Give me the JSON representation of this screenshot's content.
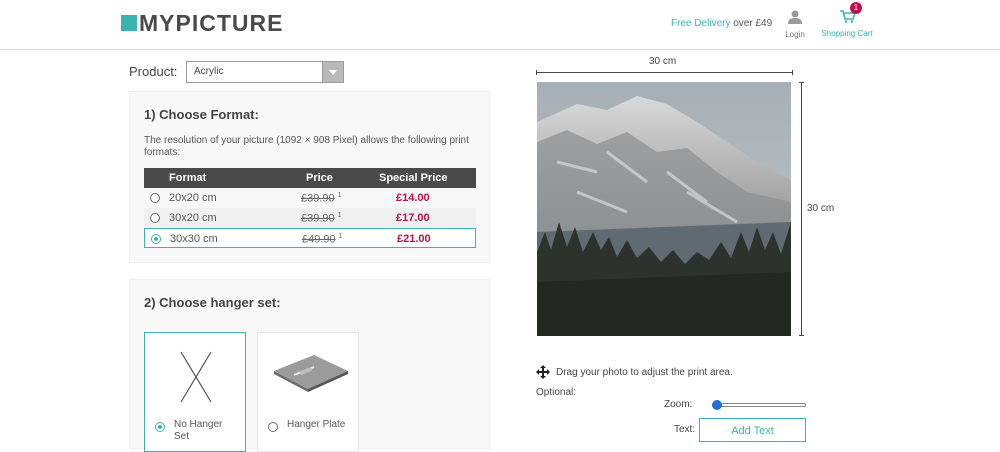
{
  "header": {
    "brand": "MYPICTURE",
    "delivery_accent": "Free Delivery",
    "delivery_rest": " over £49",
    "login_label": "Login",
    "cart_label": "Shopping Cart",
    "cart_count": "1",
    "icons": [
      "logo-square-icon",
      "user-icon",
      "cart-icon"
    ]
  },
  "product": {
    "label": "Product:",
    "selected": "Acrylic"
  },
  "format_section": {
    "title": "1) Choose Format:",
    "description": "The resolution of your picture (1092 × 908 Pixel) allows the following print formats:",
    "columns": [
      "Format",
      "Price",
      "Special Price"
    ],
    "rows": [
      {
        "format": "20x20 cm",
        "price": "£39.90",
        "footnote": "1",
        "special": "£14.00",
        "selected": false
      },
      {
        "format": "30x20 cm",
        "price": "£39.90",
        "footnote": "1",
        "special": "£17.00",
        "selected": false
      },
      {
        "format": "30x30 cm",
        "price": "£49.90",
        "footnote": "1",
        "special": "£21.00",
        "selected": true
      }
    ]
  },
  "hanger_section": {
    "title": "2) Choose hanger set:",
    "options": [
      {
        "label": "No Hanger Set",
        "selected": true
      },
      {
        "label": "Hanger Plate",
        "selected": false
      }
    ]
  },
  "preview": {
    "width_label": "30 cm",
    "height_label": "30 cm",
    "drag_hint": "Drag your photo to adjust the print area.",
    "optional_label": "Optional:",
    "zoom_label": "Zoom:",
    "zoom_level": 0,
    "text_label": "Text:",
    "add_text_button": "Add Text"
  },
  "colors": {
    "accent": "#3bb3b3",
    "price_red": "#c0114a",
    "table_header": "#4a4a4a"
  }
}
